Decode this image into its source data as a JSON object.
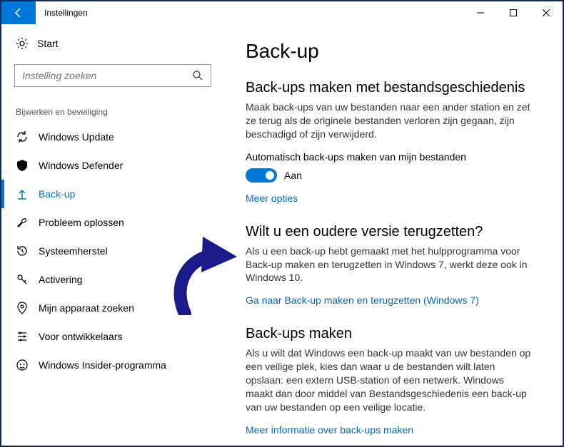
{
  "window": {
    "title": "Instellingen"
  },
  "sidebar": {
    "start_label": "Start",
    "search_placeholder": "Instelling zoeken",
    "category_title": "Bijwerken en beveiliging",
    "items": [
      {
        "label": "Windows Update"
      },
      {
        "label": "Windows Defender"
      },
      {
        "label": "Back-up"
      },
      {
        "label": "Probleem oplossen"
      },
      {
        "label": "Systeemherstel"
      },
      {
        "label": "Activering"
      },
      {
        "label": "Mijn apparaat zoeken"
      },
      {
        "label": "Voor ontwikkelaars"
      },
      {
        "label": "Windows Insider-programma"
      }
    ]
  },
  "main": {
    "page_title": "Back-up",
    "sec1": {
      "title": "Back-ups maken met bestandsgeschiedenis",
      "text": "Maak back-ups van uw bestanden naar een ander station en zet ze terug als de originele bestanden verloren zijn gegaan, zijn beschadigd of zijn verwijderd.",
      "toggle_label": "Automatisch back-ups maken van mijn bestanden",
      "toggle_state": "Aan",
      "link": "Meer opties"
    },
    "sec2": {
      "title": "Wilt u een oudere versie terugzetten?",
      "text": "Als u een back-up hebt gemaakt met het hulpprogramma voor Back-up maken en terugzetten in Windows 7, werkt deze ook in Windows 10.",
      "link": "Ga naar Back-up maken en terugzetten (Windows 7)"
    },
    "sec3": {
      "title": "Back-ups maken",
      "text": "Als u wilt dat Windows een back-up maakt van uw bestanden op een veilige plek, kies dan waar u de bestanden wilt laten opslaan: een extern USB-station of een netwerk. Windows maakt dan door middel van Bestandsgeschiedenis een back-up van uw bestanden op een veilige locatie.",
      "link": "Meer informatie over back-ups maken"
    }
  }
}
